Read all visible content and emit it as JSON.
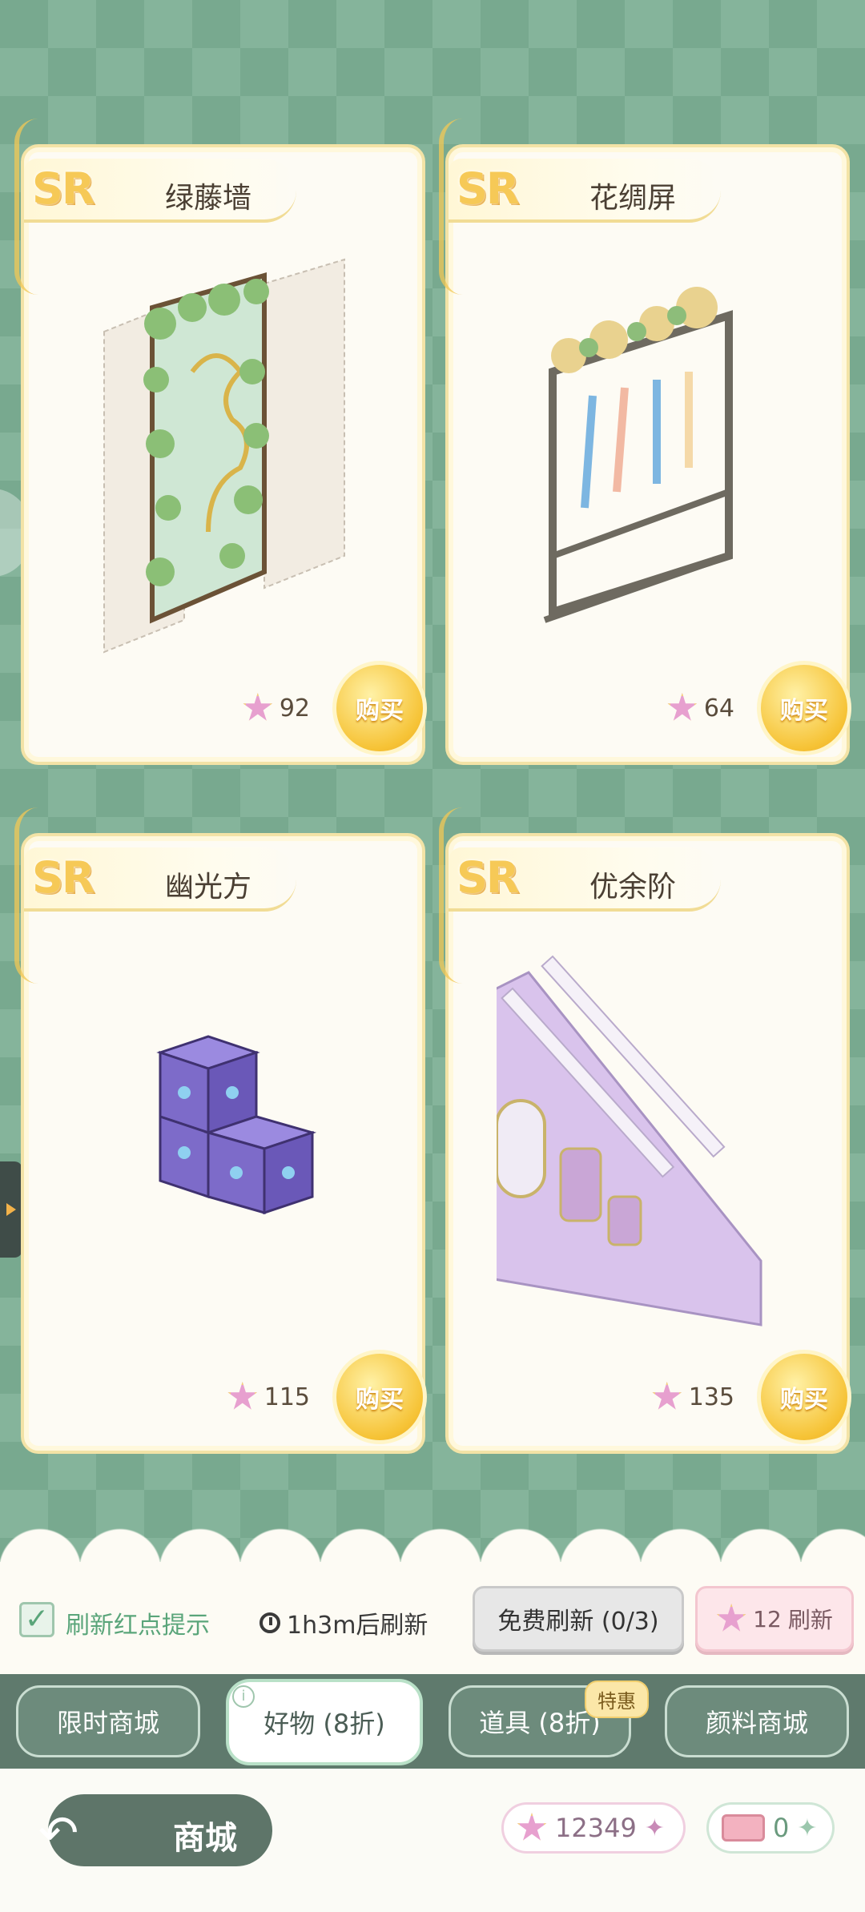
{
  "cards": [
    {
      "rarity": "SR",
      "name": "绿藤墙",
      "price": "92",
      "buy_label": "购买"
    },
    {
      "rarity": "SR",
      "name": "花绸屏",
      "price": "64",
      "buy_label": "购买"
    },
    {
      "rarity": "SR",
      "name": "幽光方",
      "price": "115",
      "buy_label": "购买"
    },
    {
      "rarity": "SR",
      "name": "优余阶",
      "price": "135",
      "buy_label": "购买"
    }
  ],
  "refresh": {
    "checkbox_label": "刷新红点提示",
    "timer": "1h3m后刷新",
    "free_button": "免费刷新 (0/3)",
    "paid_cost": "12",
    "paid_label": "刷新"
  },
  "tabs": [
    {
      "label": "限时商城"
    },
    {
      "label": "好物 (8折)"
    },
    {
      "label": "道具 (8折)",
      "badge": "特惠"
    },
    {
      "label": "颜料商城"
    }
  ],
  "bottom": {
    "title": "商城",
    "star_currency": "12349",
    "ticket_currency": "0"
  }
}
